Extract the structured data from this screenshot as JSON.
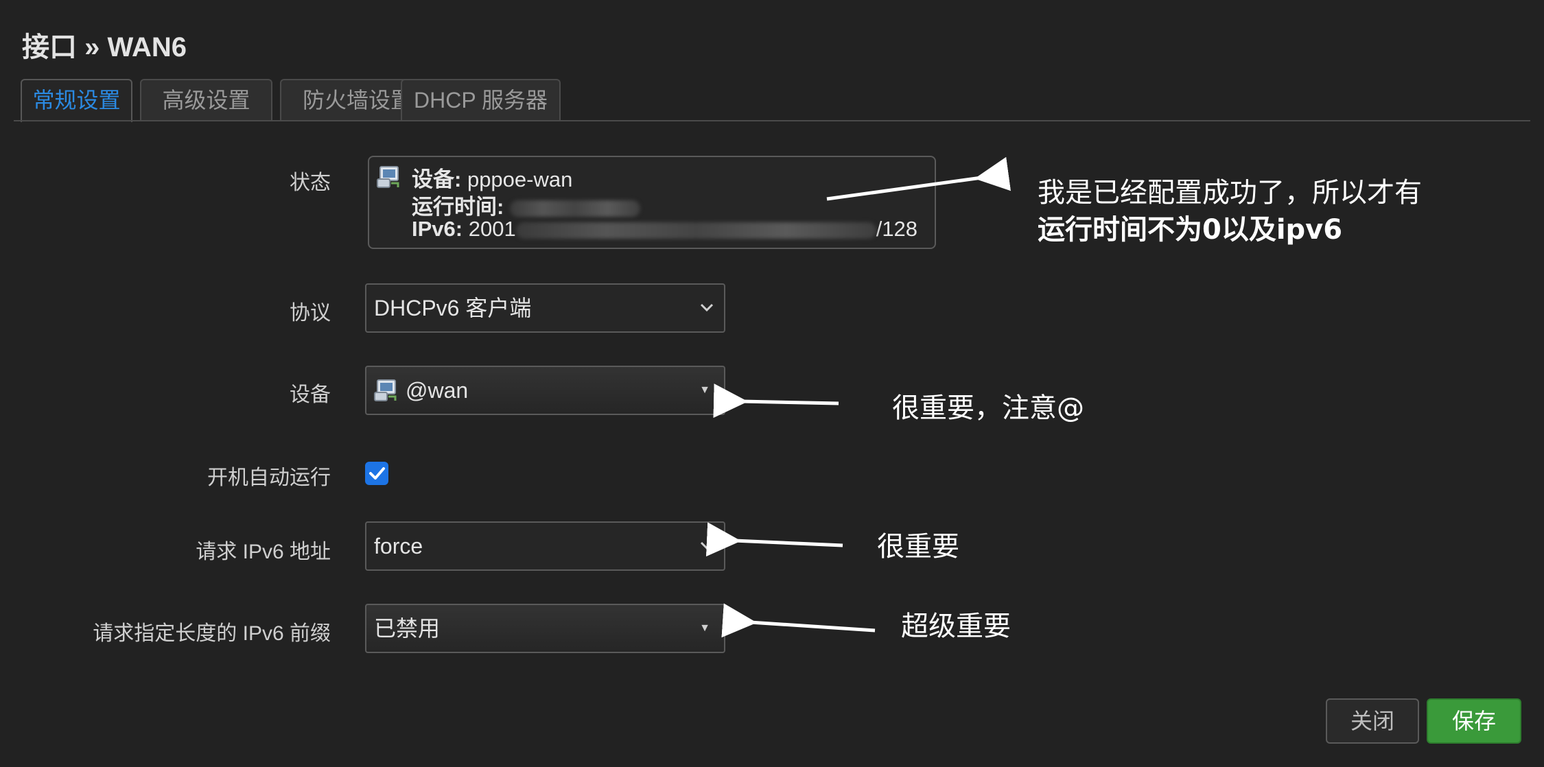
{
  "page": {
    "title": "接口 » WAN6"
  },
  "tabs": [
    {
      "label": "常规设置",
      "active": true
    },
    {
      "label": "高级设置",
      "active": false
    },
    {
      "label": "防火墙设置",
      "active": false
    },
    {
      "label": "DHCP 服务器",
      "active": false
    }
  ],
  "status": {
    "label": "状态",
    "device_key": "设备:",
    "device_value": "pppoe-wan",
    "uptime_key": "运行时间:",
    "ipv6_key": "IPv6:",
    "ipv6_prefix": "2001",
    "ipv6_suffix": "/128"
  },
  "form": {
    "protocol": {
      "label": "协议",
      "value": "DHCPv6 客户端"
    },
    "device": {
      "label": "设备",
      "value": "@wan"
    },
    "autostart": {
      "label": "开机自动运行",
      "checked": true
    },
    "request_ipv6": {
      "label": "请求 IPv6 地址",
      "value": "force"
    },
    "prefix_length": {
      "label": "请求指定长度的 IPv6 前缀",
      "value": "已禁用"
    }
  },
  "annotations": {
    "status_note_line1": "我是已经配置成功了，所以才有",
    "status_note_line2": "运行时间不为0以及ipv6",
    "device_note": "很重要，注意@",
    "request_note": "很重要",
    "prefix_note": "超级重要"
  },
  "buttons": {
    "close": "关闭",
    "save": "保存"
  },
  "colors": {
    "background": "#222222",
    "active_tab": "#2b8ae2",
    "save_button": "#3a9a3a",
    "checkbox": "#1d74e5"
  },
  "icons": {
    "network_device": "network-device-icon",
    "chevron": "chevron-down-icon",
    "dropdown_triangle": "dropdown-triangle-icon",
    "check": "check-icon"
  }
}
